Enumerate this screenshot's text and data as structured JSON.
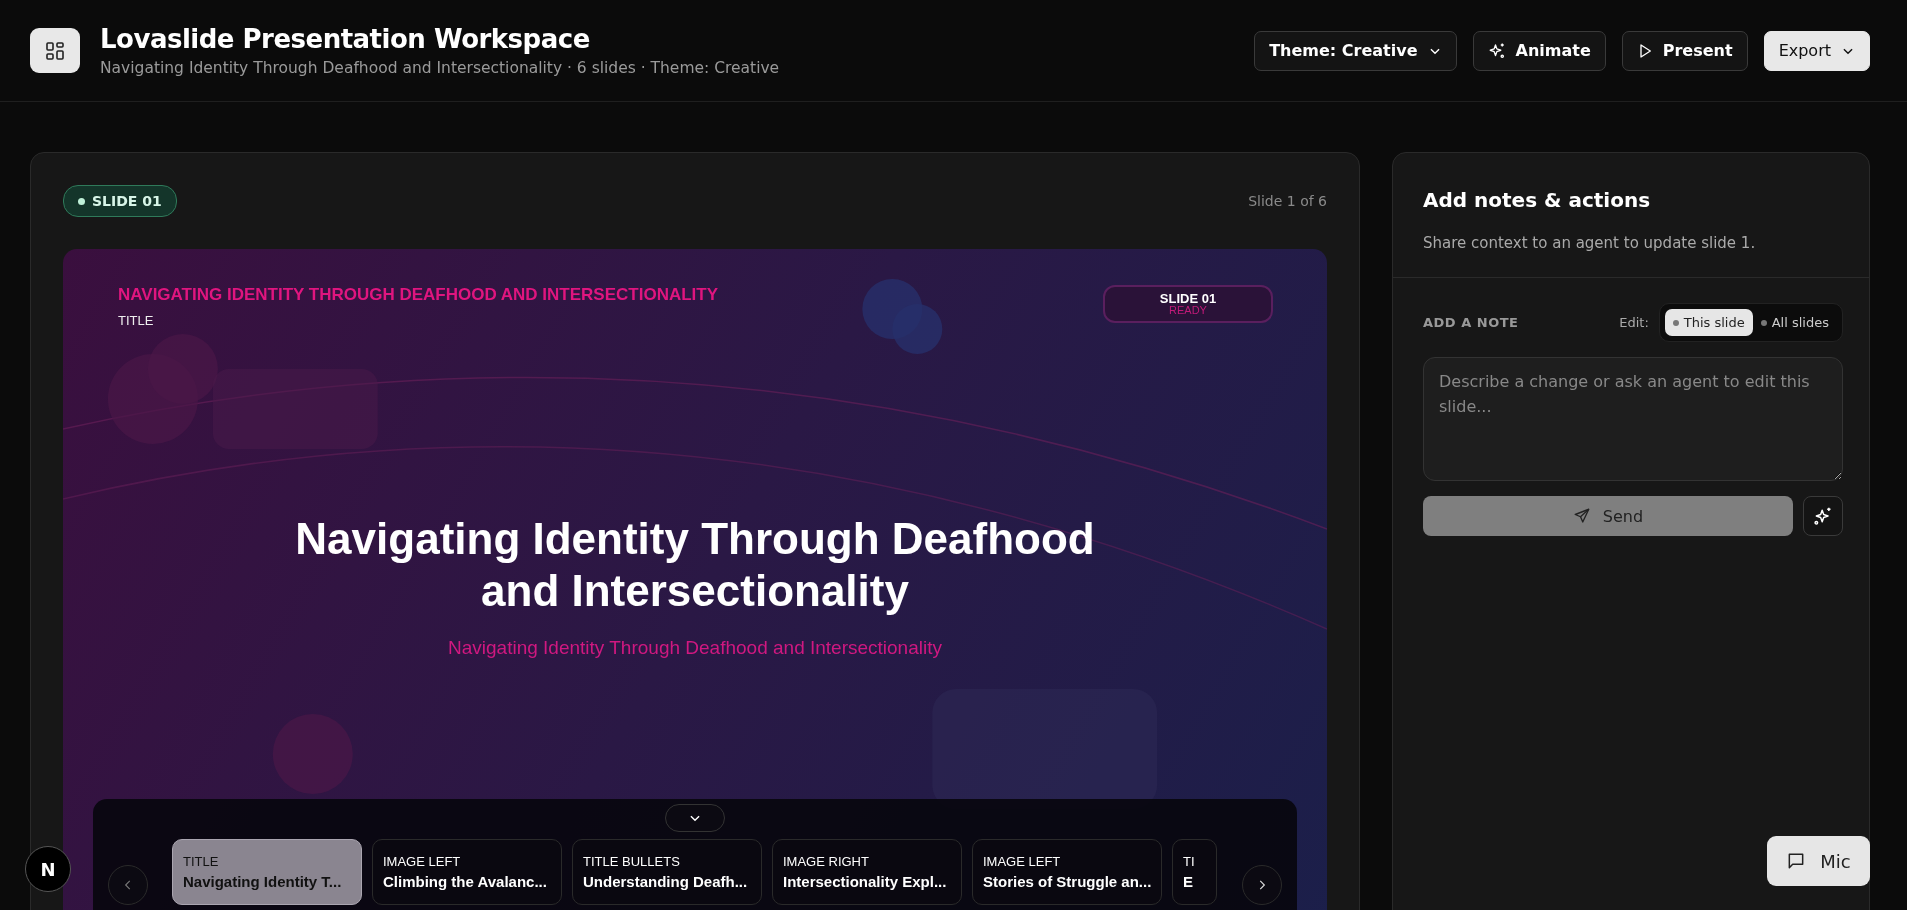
{
  "header": {
    "title": "Lovaslide Presentation Workspace",
    "subtitle": "Navigating Identity Through Deafhood and Intersectionality · 6 slides · Theme: Creative",
    "buttons": [
      {
        "label": "Theme: Creative",
        "kind": "menu",
        "primary": false
      },
      {
        "label": "Animate",
        "kind": "animate",
        "primary": false
      },
      {
        "label": "Present",
        "kind": "present",
        "primary": false
      },
      {
        "label": "Export",
        "kind": "menu",
        "primary": true
      }
    ]
  },
  "editor": {
    "badge": "SLIDE 01",
    "counter": "Slide 1 of 6",
    "slide": {
      "eyebrow": "NAVIGATING IDENTITY THROUGH DEAFHOOD AND INTERSECTIONALITY",
      "layout": "TITLE",
      "tag": "SLIDE 01",
      "status": "READY",
      "title": "Navigating Identity Through Deafhood and Intersectionality",
      "subtitle": "Navigating Identity Through Deafhood and Intersectionality"
    },
    "thumbnails": [
      {
        "layout": "TITLE",
        "title": "Navigating Identity T...",
        "selected": true
      },
      {
        "layout": "IMAGE LEFT",
        "title": "Climbing the Avalanc...",
        "selected": false
      },
      {
        "layout": "TITLE BULLETS",
        "title": "Understanding Deafh...",
        "selected": false
      },
      {
        "layout": "IMAGE RIGHT",
        "title": "Intersectionality Expl...",
        "selected": false
      },
      {
        "layout": "IMAGE LEFT",
        "title": "Stories of Struggle an...",
        "selected": false
      },
      {
        "layout": "TI",
        "title": "E",
        "selected": false
      }
    ]
  },
  "notes": {
    "title": "Add notes & actions",
    "description": "Share context to an agent to update slide 1.",
    "section_label": "ADD A NOTE",
    "edit_label": "Edit:",
    "scopes": [
      {
        "label": "This slide",
        "selected": true
      },
      {
        "label": "All slides",
        "selected": false
      }
    ],
    "placeholder": "Describe a change or ask an agent to edit this slide...",
    "send": "Send"
  },
  "avatar": "N",
  "mic": "Mic"
}
